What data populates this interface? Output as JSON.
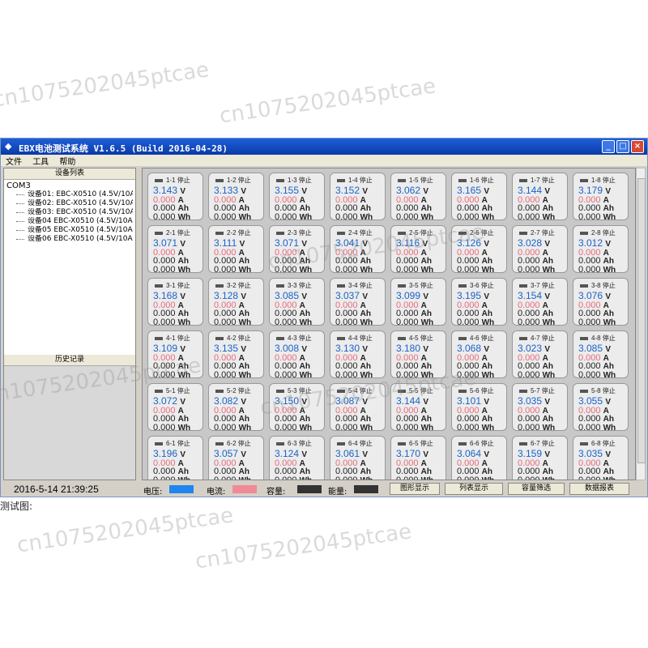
{
  "window": {
    "title": "EBX电池测试系统 V1.6.5 (Build 2016-04-28)",
    "icon": "app-icon",
    "controls": {
      "minimize": "_",
      "maximize": "□",
      "close": "×"
    }
  },
  "menu": {
    "items": [
      "文件",
      "工具",
      "帮助"
    ]
  },
  "left_panel": {
    "device_list_header": "设备列表",
    "port": "COM3",
    "devices": [
      "设备01: EBC-X0510 (4.5V/10A",
      "设备02: EBC-X0510 (4.5V/10A",
      "设备03: EBC-X0510 (4.5V/10A",
      "设备04 EBC-X0510 (4.5V/10A",
      "设备05 EBC-X0510 (4.5V/10A",
      "设备06 EBC-X0510 (4.5V/10A"
    ],
    "history_header": "历史记录"
  },
  "grid": {
    "status": "停止",
    "units": {
      "v": "V",
      "a": "A",
      "ah": "Ah",
      "wh": "Wh"
    },
    "current": "0.000",
    "capacity": "0.000",
    "energy": "0.000",
    "rows": [
      [
        "3.143",
        "3.133",
        "3.155",
        "3.152",
        "3.062",
        "3.165",
        "3.144",
        "3.179"
      ],
      [
        "3.071",
        "3.111",
        "3.071",
        "3.041",
        "3.116",
        "3.126",
        "3.028",
        "3.012"
      ],
      [
        "3.168",
        "3.128",
        "3.085",
        "3.037",
        "3.099",
        "3.195",
        "3.154",
        "3.076"
      ],
      [
        "3.109",
        "3.135",
        "3.008",
        "3.130",
        "3.180",
        "3.068",
        "3.023",
        "3.085"
      ],
      [
        "3.072",
        "3.082",
        "3.150",
        "3.087",
        "3.144",
        "3.101",
        "3.035",
        "3.055"
      ],
      [
        "3.196",
        "3.057",
        "3.124",
        "3.061",
        "3.170",
        "3.064",
        "3.159",
        "3.035"
      ]
    ]
  },
  "status_bar": {
    "datetime": "2016-5-14  21:39:25",
    "legend": [
      {
        "label": "电压:",
        "color": "#1f86f0"
      },
      {
        "label": "电流:",
        "color": "#f08a96"
      },
      {
        "label": "容量:",
        "color": "#333333"
      },
      {
        "label": "能量:",
        "color": "#333333"
      }
    ],
    "buttons": [
      "图形显示",
      "列表显示",
      "容量筛选",
      "数据报表"
    ]
  },
  "caption": "测试图:",
  "watermark": "cn1075202045ptcae"
}
